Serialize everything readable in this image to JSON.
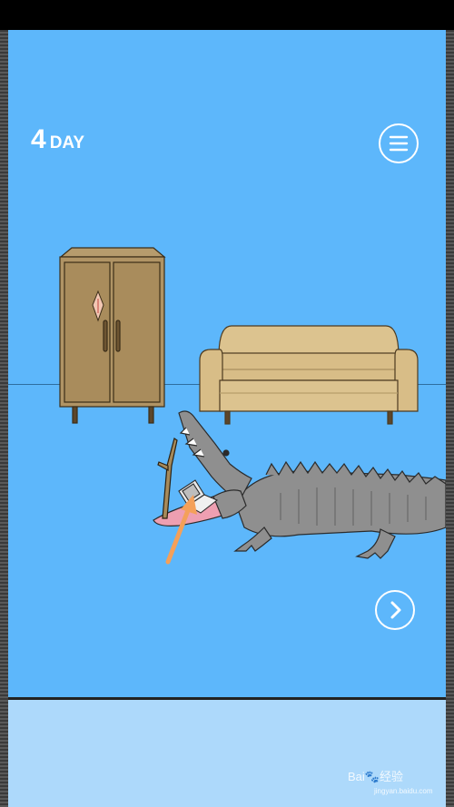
{
  "hud": {
    "day_number": "4",
    "day_word": "DAY"
  },
  "icons": {
    "menu": "hamburger-menu-icon",
    "next": "chevron-right-icon"
  },
  "scene": {
    "objects": [
      "wardrobe",
      "sofa",
      "crocodile",
      "stick",
      "handheld-game-console",
      "orange-hint-arrow"
    ]
  },
  "watermark": {
    "brand": "Bai",
    "brand_suffix": "经验",
    "url": "jingyan.baidu.com"
  },
  "colors": {
    "sky": "#5db7fb",
    "panel": "#add9fb",
    "wood": "#b09465",
    "sofa": "#dcc38f",
    "croc": "#8f8f8f",
    "arrow": "#f4a05a"
  }
}
